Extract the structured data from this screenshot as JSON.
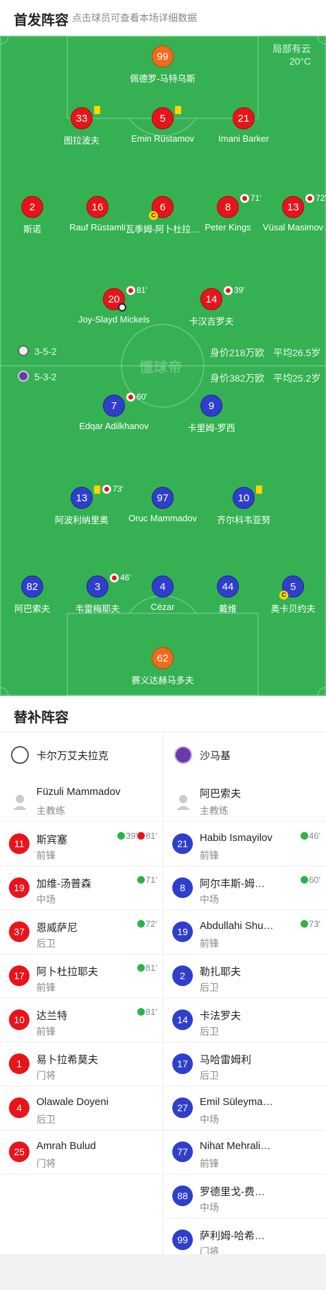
{
  "header": {
    "title": "首发阵容",
    "subtitle": "点击球员可查看本场详细数据"
  },
  "weather": {
    "condition": "局部有云",
    "temp": "20°C"
  },
  "watermark": "懂球帝",
  "home_team_row": {
    "formation": "3-5-2",
    "value": "身价218万欧",
    "age": "平均26.5岁",
    "color": "#8a8a8a"
  },
  "away_team_row": {
    "formation": "5-3-2",
    "value": "身价382万欧",
    "age": "平均25.2岁",
    "color": "#6a3aa8"
  },
  "home_players": [
    {
      "num": "99",
      "name": "佩德罗-马特乌斯",
      "color": "orange"
    },
    {
      "num": "33",
      "name": "图拉波夫",
      "color": "red",
      "yellow": true
    },
    {
      "num": "5",
      "name": "Emin Rüstamov",
      "color": "red",
      "yellow": true
    },
    {
      "num": "21",
      "name": "Imani Barker",
      "color": "red"
    },
    {
      "num": "2",
      "name": "斯诺",
      "color": "red"
    },
    {
      "num": "16",
      "name": "Rauf Rüstamli",
      "color": "red"
    },
    {
      "num": "6",
      "name": "瓦季姆-阿卜杜拉…",
      "color": "red",
      "captain": "C"
    },
    {
      "num": "8",
      "name": "Peter Kings",
      "color": "red",
      "sub_min": "71'"
    },
    {
      "num": "13",
      "name": "Vüsal Masimov",
      "color": "red",
      "sub_min": "72'"
    },
    {
      "num": "20",
      "name": "Joy-Slayd Mickels",
      "color": "red",
      "sub_min": "81'",
      "goal": true
    },
    {
      "num": "14",
      "name": "卡汉吉罗夫",
      "color": "red",
      "sub_min": "39'"
    }
  ],
  "away_players": [
    {
      "num": "7",
      "name": "Edqar Adilkhanov",
      "color": "blue",
      "sub_min": "60'"
    },
    {
      "num": "9",
      "name": "卡里姆-罗西",
      "color": "blue"
    },
    {
      "num": "13",
      "name": "阿波利纳里奥",
      "color": "blue",
      "yellow": true,
      "sub_min": "73'"
    },
    {
      "num": "97",
      "name": "Oruc Mammadov",
      "color": "blue"
    },
    {
      "num": "10",
      "name": "齐尔科韦亚努",
      "color": "blue",
      "yellow": true
    },
    {
      "num": "82",
      "name": "阿巴索夫",
      "color": "blue"
    },
    {
      "num": "3",
      "name": "韦雷梅耶夫",
      "color": "blue",
      "sub_min": "46'"
    },
    {
      "num": "4",
      "name": "Cézar",
      "color": "blue"
    },
    {
      "num": "44",
      "name": "戴维",
      "color": "blue"
    },
    {
      "num": "5",
      "name": "奥卡贝约夫",
      "color": "blue",
      "captain": "C"
    },
    {
      "num": "62",
      "name": "赛义达赫马多夫",
      "color": "orange"
    }
  ],
  "subs": {
    "title": "替补阵容",
    "home": {
      "team_name": "卡尔万艾夫拉克",
      "coach_name": "Füzuli Mammadov",
      "coach_role": "主教练",
      "players": [
        {
          "num": "11",
          "name": "斯宾塞",
          "pos": "前锋",
          "ev_in": "39'",
          "ev_out": "81'"
        },
        {
          "num": "19",
          "name": "加维-汤普森",
          "pos": "中场",
          "ev_in": "71'"
        },
        {
          "num": "37",
          "name": "恩威萨尼",
          "pos": "后卫",
          "ev_in": "72'"
        },
        {
          "num": "17",
          "name": "阿卜杜拉耶夫",
          "pos": "前锋",
          "ev_in": "81'"
        },
        {
          "num": "10",
          "name": "达兰特",
          "pos": "前锋",
          "ev_in": "81'"
        },
        {
          "num": "1",
          "name": "易卜拉希莫夫",
          "pos": "门将"
        },
        {
          "num": "4",
          "name": "Olawale Doyeni",
          "pos": "后卫"
        },
        {
          "num": "25",
          "name": "Amrah Bulud",
          "pos": "门将"
        }
      ]
    },
    "away": {
      "team_name": "沙马基",
      "coach_name": "阿巴索夫",
      "coach_role": "主教练",
      "players": [
        {
          "num": "21",
          "name": "Habib Ismayilov",
          "pos": "前锋",
          "ev_in": "46'"
        },
        {
          "num": "8",
          "name": "阿尔丰斯-姆…",
          "pos": "中场",
          "ev_in": "60'"
        },
        {
          "num": "19",
          "name": "Abdullahi Shu…",
          "pos": "前锋",
          "ev_in": "73'"
        },
        {
          "num": "2",
          "name": "勒扎耶夫",
          "pos": "后卫"
        },
        {
          "num": "14",
          "name": "卡法罗夫",
          "pos": "后卫"
        },
        {
          "num": "17",
          "name": "马哈雷姆利",
          "pos": "后卫"
        },
        {
          "num": "27",
          "name": "Emil Süleyma…",
          "pos": "中场"
        },
        {
          "num": "77",
          "name": "Nihat Mehrali…",
          "pos": "前锋"
        },
        {
          "num": "88",
          "name": "罗德里戈-费…",
          "pos": "中场"
        },
        {
          "num": "99",
          "name": "萨利姆-哈希…",
          "pos": "门将"
        }
      ]
    }
  }
}
